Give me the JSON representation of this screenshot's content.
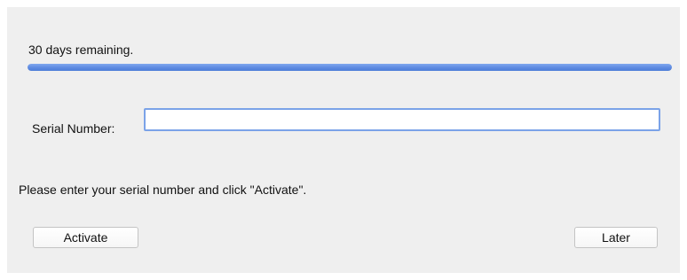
{
  "status": {
    "days_remaining_text": "30 days remaining.",
    "progress_fraction": 1.0
  },
  "serial": {
    "label": "Serial Number:",
    "value": "",
    "placeholder": ""
  },
  "hint": {
    "text": "Please enter your serial number and click \"Activate\"."
  },
  "buttons": {
    "activate_label": "Activate",
    "later_label": "Later"
  },
  "colors": {
    "panel_background": "#efefef",
    "progress_accent": "#5b88e0",
    "input_focus_border": "#7ba3e8"
  }
}
